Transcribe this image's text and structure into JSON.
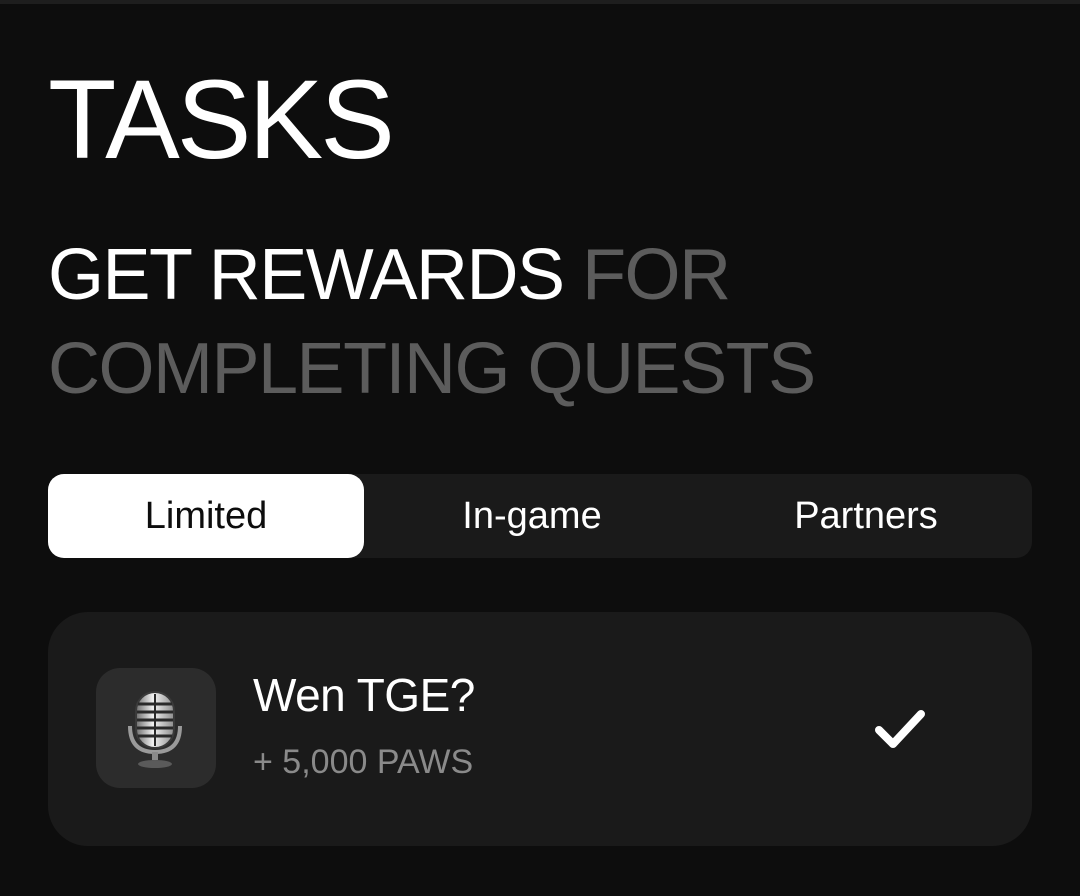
{
  "header": {
    "title": "TASKS",
    "subtitle_highlight": "GET REWARDS",
    "subtitle_rest": "FOR COMPLETING QUESTS"
  },
  "tabs": [
    {
      "label": "Limited",
      "active": true
    },
    {
      "label": "In-game",
      "active": false
    },
    {
      "label": "Partners",
      "active": false
    }
  ],
  "tasks": [
    {
      "icon": "microphone-icon",
      "title": "Wen TGE?",
      "reward": "+ 5,000 PAWS",
      "status": "completed",
      "status_icon": "checkmark-icon"
    }
  ],
  "colors": {
    "background": "#0d0d0d",
    "surface": "#1a1a1a",
    "text_primary": "#ffffff",
    "text_dim": "#5c5c5c",
    "text_secondary": "#8a8a8a"
  }
}
